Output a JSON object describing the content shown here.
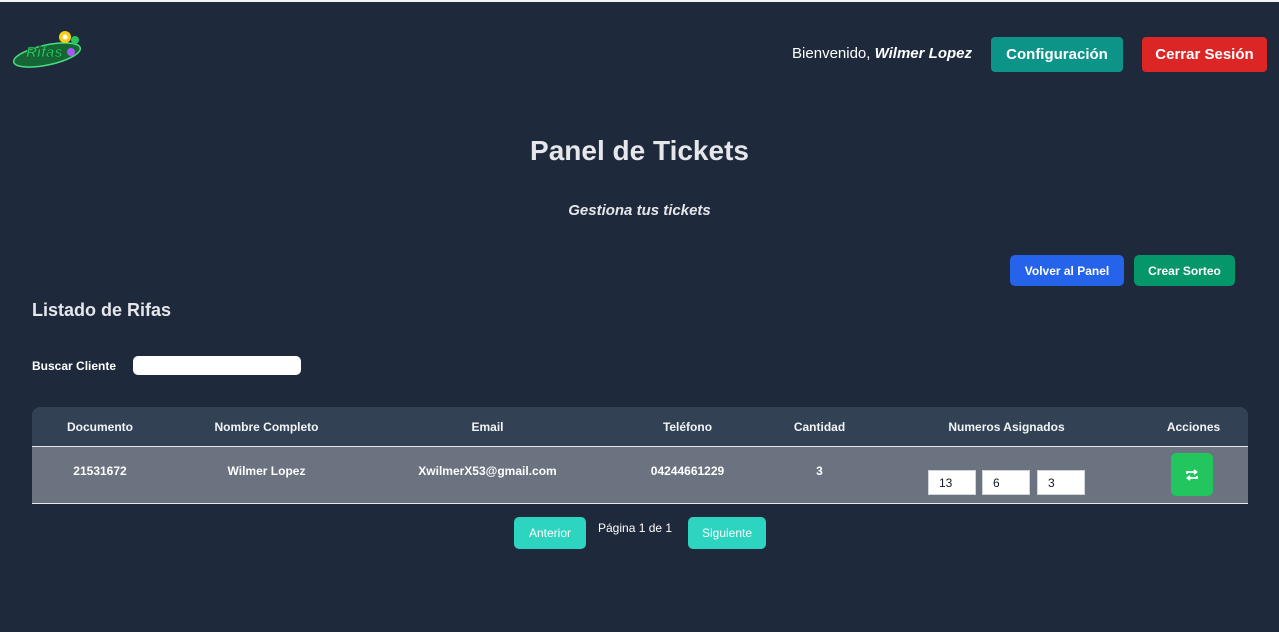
{
  "header": {
    "logo_text": "Rifas",
    "welcome_prefix": "Bienvenido, ",
    "user_name": "Wilmer Lopez",
    "config_label": "Configuración",
    "logout_label": "Cerrar Sesión"
  },
  "main": {
    "title": "Panel de Tickets",
    "subtitle": "Gestiona tus tickets",
    "back_label": "Volver al Panel",
    "create_label": "Crear Sorteo",
    "section_title": "Listado de Rifas",
    "search_label": "Buscar Cliente",
    "search_value": ""
  },
  "table": {
    "headers": [
      "Documento",
      "Nombre Completo",
      "Email",
      "Teléfono",
      "Cantidad",
      "Numeros Asignados",
      "Acciones"
    ],
    "rows": [
      {
        "documento": "21531672",
        "nombre": "Wilmer Lopez",
        "email": "XwilmerX53@gmail.com",
        "telefono": "04244661229",
        "cantidad": "3",
        "numeros": [
          "13",
          "6",
          "3"
        ]
      }
    ]
  },
  "pagination": {
    "prev_label": "Anterior",
    "info": "Página 1 de 1",
    "next_label": "Siguiente"
  },
  "icons": {
    "action": "swap-icon",
    "logo": "rifas-logo"
  },
  "colors": {
    "background": "#1e293b",
    "config": "#0d9488",
    "logout": "#dc2626",
    "back": "#2563eb",
    "create": "#059669",
    "action": "#22c55e",
    "pagination": "#2dd4bf"
  }
}
